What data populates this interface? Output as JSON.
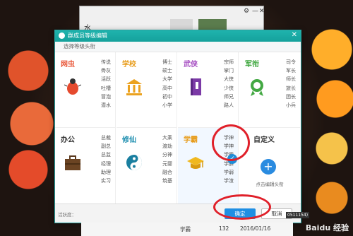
{
  "back_window": {
    "title": "水",
    "controls": [
      "⚙",
      "—",
      "✕"
    ]
  },
  "dialog": {
    "title": "群成员等级编辑",
    "subtitle": "选择等级头衔",
    "close_label": "✕"
  },
  "categories": [
    {
      "name": "网虫",
      "name_color": "#e9583a",
      "icon": "bug-icon",
      "titles": [
        "传说",
        "骨灰",
        "活跃",
        "吐槽",
        "冒泡",
        "潜水"
      ]
    },
    {
      "name": "学校",
      "name_color": "#e79a16",
      "icon": "school-icon",
      "titles": [
        "博士",
        "硕士",
        "大学",
        "高中",
        "初中",
        "小学"
      ]
    },
    {
      "name": "武侠",
      "name_color": "#a54cc1",
      "icon": "book-icon",
      "titles": [
        "宗师",
        "掌门",
        "大侠",
        "少侠",
        "师兄",
        "路人"
      ]
    },
    {
      "name": "军衔",
      "name_color": "#3aa53a",
      "icon": "medal-icon",
      "titles": [
        "司令",
        "军长",
        "师长",
        "旅长",
        "团长",
        "小兵"
      ]
    },
    {
      "name": "办公",
      "name_color": "#333333",
      "icon": "briefcase-icon",
      "titles": [
        "总裁",
        "副总",
        "总监",
        "经理",
        "助理",
        "实习"
      ]
    },
    {
      "name": "修仙",
      "name_color": "#1f8fb0",
      "icon": "taiji-icon",
      "titles": [
        "大乘",
        "渡劫",
        "分神",
        "元婴",
        "融合",
        "筑基"
      ]
    },
    {
      "name": "学霸",
      "name_color": "#e79a16",
      "icon": "graduation-cap-icon",
      "titles": [
        "学神",
        "学神",
        "学霸",
        "学酥",
        "学弱",
        "学渣"
      ]
    },
    {
      "name": "自定义",
      "name_color": "#333333",
      "icon": "add-icon",
      "titles": [],
      "hint": "点击编辑头衔"
    }
  ],
  "selected_category": "学霸",
  "footer": {
    "left_text": "活跃度：",
    "ok_label": "确定",
    "cancel_label": "取消"
  },
  "bottom_row": {
    "label": "学霸",
    "count": "132",
    "date": "2016/01/16"
  },
  "side_tag": "0511154)",
  "watermark": "Baidu 经验"
}
